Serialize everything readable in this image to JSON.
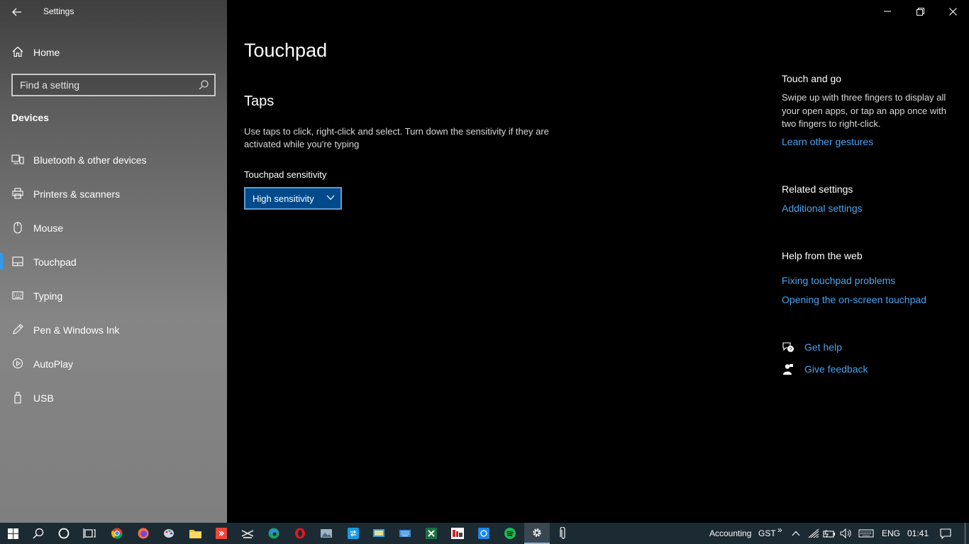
{
  "window": {
    "title": "Settings"
  },
  "sidebar": {
    "home_label": "Home",
    "search_placeholder": "Find a setting",
    "section_title": "Devices",
    "items": [
      {
        "label": "Bluetooth & other devices",
        "icon": "bluetooth-devices-icon"
      },
      {
        "label": "Printers & scanners",
        "icon": "printer-icon"
      },
      {
        "label": "Mouse",
        "icon": "mouse-icon"
      },
      {
        "label": "Touchpad",
        "icon": "touchpad-icon",
        "selected": true
      },
      {
        "label": "Typing",
        "icon": "keyboard-icon"
      },
      {
        "label": "Pen & Windows Ink",
        "icon": "pen-icon"
      },
      {
        "label": "AutoPlay",
        "icon": "autoplay-icon"
      },
      {
        "label": "USB",
        "icon": "usb-icon"
      }
    ]
  },
  "main": {
    "title": "Touchpad",
    "section_title": "Taps",
    "description": "Use taps to click, right-click and select. Turn down the sensitivity if they are activated while you're typing",
    "sensitivity_label": "Touchpad sensitivity",
    "sensitivity_value": "High sensitivity"
  },
  "right": {
    "touch_title": "Touch and go",
    "touch_desc": "Swipe up with three fingers to display all your open apps, or tap an app once with two fingers to right-click.",
    "learn_link": "Learn other gestures",
    "related_title": "Related settings",
    "additional_link": "Additional settings",
    "help_title": "Help from the web",
    "help_links": [
      "Fixing touchpad problems",
      "Opening the on-screen touchpad"
    ],
    "get_help": "Get help",
    "give_feedback": "Give feedback"
  },
  "taskbar": {
    "tray_text": "Accounting",
    "gst": "GST",
    "chevron": "»",
    "lang": "ENG",
    "time": "01:41"
  },
  "colors": {
    "accent": "#2a9bf1",
    "link": "#4aa3f0",
    "dropdown_bg": "#004a8c",
    "taskbar_bg": "#1c2a33"
  }
}
